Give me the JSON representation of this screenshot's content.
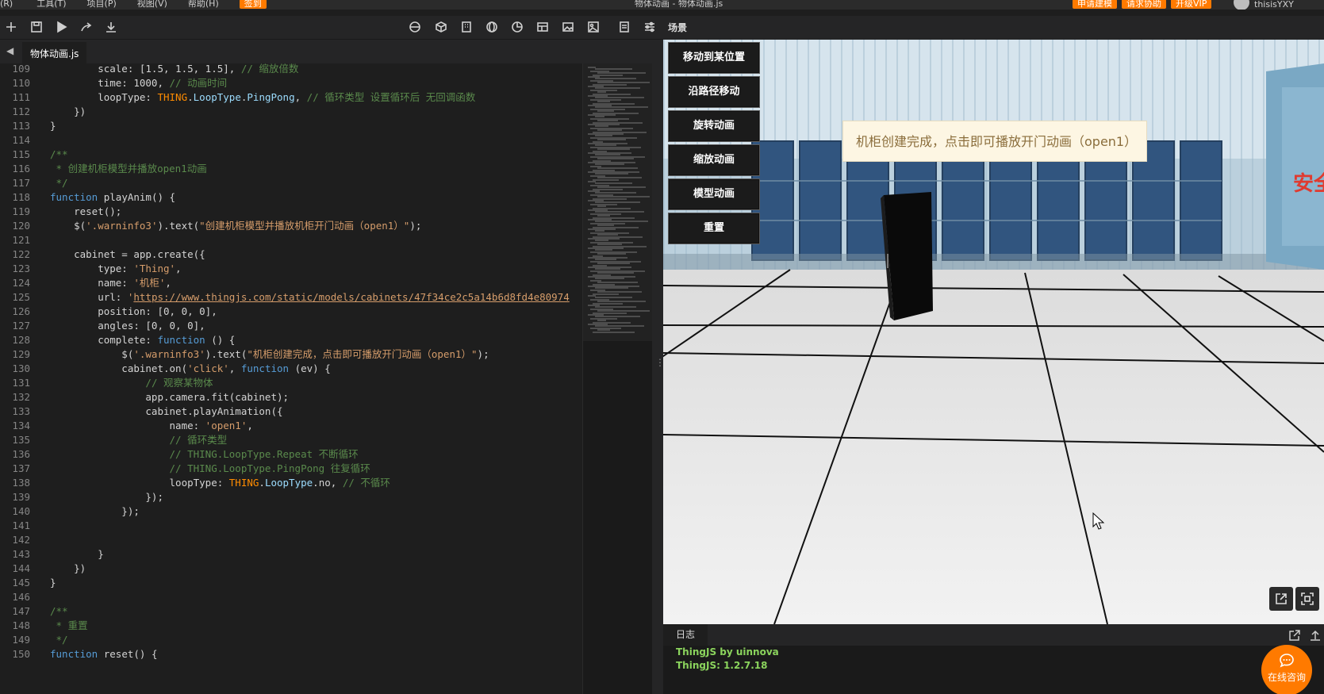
{
  "menubar": {
    "items": [
      "(R)",
      "工具(T)",
      "项目(P)",
      "视图(V)",
      "帮助(H)"
    ],
    "signin": "签到",
    "window_title": "物体动画 - 物体动画.js",
    "actions": [
      "申请建模",
      "请求协助",
      "开级VIP"
    ],
    "username": "thisisYXY"
  },
  "toolbar": {
    "left_icons": [
      "new-file-icon",
      "save-icon",
      "run-icon",
      "share-icon",
      "download-icon"
    ],
    "right_icons": [
      "sphere-icon",
      "cube-icon",
      "building-icon",
      "globe-icon",
      "chart-icon",
      "table-icon",
      "image-icon",
      "gallery-icon",
      "document-icon",
      "settings-icon"
    ]
  },
  "editor": {
    "active_tab": "物体动画.js",
    "lines": [
      {
        "n": "109",
        "html": "        scale: [1.5, 1.5, 1.5], <span class=\"c\">// 缩放倍数</span>"
      },
      {
        "n": "110",
        "html": "        time: 1000, <span class=\"c\">// 动画时间</span>"
      },
      {
        "n": "111",
        "html": "        loopType: <span class=\"t\">THING</span>.<span class=\"p\">LoopType</span>.<span class=\"p\">PingPong</span>, <span class=\"c\">// 循环类型 设置循环后 无回调函数</span>"
      },
      {
        "n": "112",
        "html": "    })"
      },
      {
        "n": "113",
        "html": "}"
      },
      {
        "n": "114",
        "html": ""
      },
      {
        "n": "115",
        "html": "<span class=\"c\">/**</span>"
      },
      {
        "n": "116",
        "html": "<span class=\"c\"> * 创建机柜模型并播放open1动画</span>"
      },
      {
        "n": "117",
        "html": "<span class=\"c\"> */</span>"
      },
      {
        "n": "118",
        "html": "<span class=\"k\">function</span> playAnim() {"
      },
      {
        "n": "119",
        "html": "    reset();"
      },
      {
        "n": "120",
        "html": "    $(<span class=\"s\">'.warninfo3'</span>).text(<span class=\"s\">\"创建机柜模型并播放机柜开门动画（open1）\"</span>);"
      },
      {
        "n": "121",
        "html": ""
      },
      {
        "n": "122",
        "html": "    cabinet = app.create({"
      },
      {
        "n": "123",
        "html": "        type: <span class=\"s\">'Thing'</span>,"
      },
      {
        "n": "124",
        "html": "        name: <span class=\"s\">'机柜'</span>,"
      },
      {
        "n": "125",
        "html": "        url: <span class=\"s\">'</span><span class=\"u\">https://www.thingjs.com/static/models/cabinets/47f34ce2c5a14b6d8fd4e80974</span>"
      },
      {
        "n": "126",
        "html": "        position: [0, 0, 0],"
      },
      {
        "n": "127",
        "html": "        angles: [0, 0, 0],"
      },
      {
        "n": "128",
        "html": "        complete: <span class=\"k\">function</span> () {"
      },
      {
        "n": "129",
        "html": "            $(<span class=\"s\">'.warninfo3'</span>).text(<span class=\"s\">\"机柜创建完成，点击即可播放开门动画（open1）\"</span>);"
      },
      {
        "n": "130",
        "html": "            cabinet.on(<span class=\"s\">'click'</span>, <span class=\"k\">function</span> (ev) {"
      },
      {
        "n": "131",
        "html": "                <span class=\"c\">// 观察某物体</span>"
      },
      {
        "n": "132",
        "html": "                app.camera.fit(cabinet);"
      },
      {
        "n": "133",
        "html": "                cabinet.playAnimation({"
      },
      {
        "n": "134",
        "html": "                    name: <span class=\"s\">'open1'</span>,"
      },
      {
        "n": "135",
        "html": "                    <span class=\"c\">// 循环类型</span>"
      },
      {
        "n": "136",
        "html": "                    <span class=\"c\">// THING.LoopType.Repeat 不断循环</span>"
      },
      {
        "n": "137",
        "html": "                    <span class=\"c\">// THING.LoopType.PingPong 往复循环</span>"
      },
      {
        "n": "138",
        "html": "                    loopType: <span class=\"t\">THING</span>.<span class=\"p\">LoopType</span>.no, <span class=\"c\">// 不循环</span>"
      },
      {
        "n": "139",
        "html": "                });"
      },
      {
        "n": "140",
        "html": "            });"
      },
      {
        "n": "141",
        "html": ""
      },
      {
        "n": "142",
        "html": ""
      },
      {
        "n": "143",
        "html": "        }"
      },
      {
        "n": "144",
        "html": "    })"
      },
      {
        "n": "145",
        "html": "}"
      },
      {
        "n": "146",
        "html": ""
      },
      {
        "n": "147",
        "html": "<span class=\"c\">/**</span>"
      },
      {
        "n": "148",
        "html": "<span class=\"c\"> * 重置</span>"
      },
      {
        "n": "149",
        "html": "<span class=\"c\"> */</span>"
      },
      {
        "n": "150",
        "html": "<span class=\"k\">function</span> reset() {"
      }
    ]
  },
  "scene": {
    "title": "场景",
    "buttons": [
      "移动到某位置",
      "沿路径移动",
      "旋转动画",
      "缩放动画",
      "模型动画",
      "重置"
    ],
    "warninfo": "机柜创建完成，点击即可播放开门动画（open1）",
    "sign_text": "安全"
  },
  "log": {
    "tab": "日志",
    "lines": [
      "ThingJS by uinnova",
      "ThingJS: 1.2.7.18"
    ]
  },
  "chat": {
    "label": "在线咨询"
  },
  "colors": {
    "accent": "#ff7a00",
    "log_text": "#8bd45d",
    "editor_bg": "#1e1e1e"
  }
}
